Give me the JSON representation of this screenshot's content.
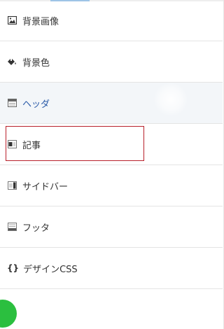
{
  "colors": {
    "highlight_border": "#b8202a",
    "active_text": "#2a5aa8",
    "active_background": "#f3f6f9",
    "fab": "#2bbf3f"
  },
  "menu": {
    "active_item": "header",
    "highlighted_item": "article",
    "items": [
      {
        "id": "background-image",
        "icon": "image-icon",
        "label": "背景画像"
      },
      {
        "id": "background-color",
        "icon": "paint-bucket-icon",
        "label": "背景色"
      },
      {
        "id": "header",
        "icon": "header-layout-icon",
        "label": "ヘッダ"
      },
      {
        "id": "article",
        "icon": "article-layout-icon",
        "label": "記事"
      },
      {
        "id": "sidebar",
        "icon": "sidebar-layout-icon",
        "label": "サイドバー"
      },
      {
        "id": "footer",
        "icon": "footer-layout-icon",
        "label": "フッタ"
      },
      {
        "id": "design-css",
        "icon": "braces-icon",
        "icon_text": "{}",
        "label": "デザインCSS"
      }
    ]
  }
}
